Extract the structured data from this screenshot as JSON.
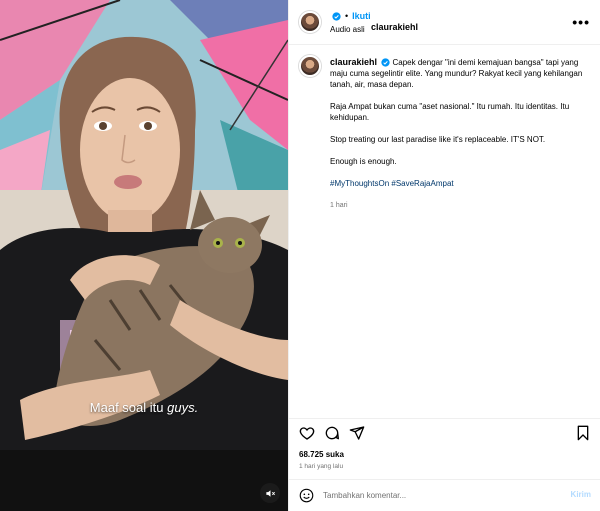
{
  "post": {
    "username": "claurakiehl",
    "follow_label": "Ikuti",
    "separator": "•",
    "audio_label": "Audio asli",
    "more_label": "•••"
  },
  "caption": {
    "username": "claurakiehl",
    "paragraphs": [
      "Capek dengar \"ini demi kemajuan bangsa\" tapi yang maju cuma segelintir elite. Yang mundur? Rakyat kecil yang kehilangan tanah, air, masa depan.",
      "Raja Ampat bukan cuma \"aset nasional.\" Itu rumah. Itu identitas. Itu kehidupan.",
      "Stop treating our last paradise like it's replaceable. IT'S NOT.",
      "Enough is enough."
    ],
    "hashtags": "#MyThoughtsOn #SaveRajaAmpat",
    "time_ago": "1 hari"
  },
  "video": {
    "subtitle_main": "Maaf soal itu ",
    "subtitle_emph": "guys."
  },
  "actions": {
    "icons": [
      "heart-icon",
      "comment-icon",
      "share-icon",
      "bookmark-icon"
    ],
    "likes": "68.725 suka",
    "date": "1 hari yang lalu"
  },
  "comment": {
    "placeholder": "Tambahkan komentar...",
    "post_label": "Kirim"
  },
  "colors": {
    "link_blue": "#0095f6",
    "hashtag_blue": "#00376b",
    "muted": "#737373",
    "post_disabled": "#b3dbff",
    "verified": "#0095f6"
  }
}
